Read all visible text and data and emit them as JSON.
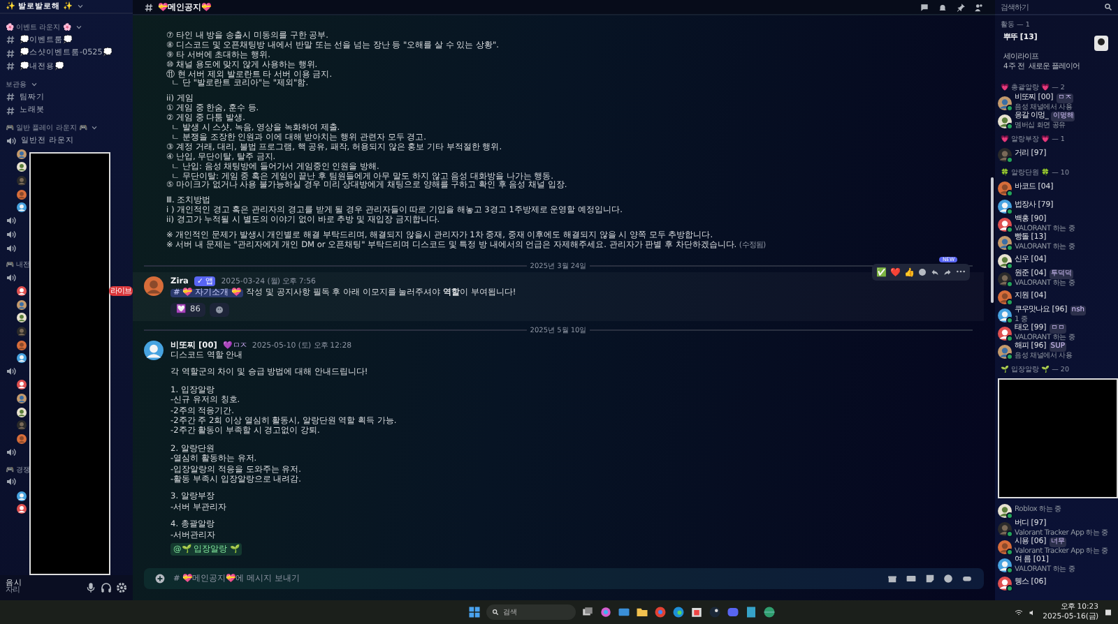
{
  "server": {
    "name": "✨ 발로발로해 ✨"
  },
  "sidebar": {
    "items": [
      {
        "kind": "category",
        "label": "🌸 이벤트 라운지 🌸"
      },
      {
        "kind": "text",
        "label": "💭이벤트룸💭"
      },
      {
        "kind": "text",
        "label": "💭스샷이벤트룸-0525💭"
      },
      {
        "kind": "text",
        "label": "💭내전용💭"
      },
      {
        "kind": "category",
        "label": "보관용"
      },
      {
        "kind": "text",
        "label": "팀짜기"
      },
      {
        "kind": "text",
        "label": "노래봇"
      },
      {
        "kind": "category",
        "label": "🎮 일반 플레이 라운지 🎮"
      },
      {
        "kind": "voice",
        "label": "일반전 라운지"
      },
      {
        "kind": "user"
      },
      {
        "kind": "user"
      },
      {
        "kind": "user"
      },
      {
        "kind": "user"
      },
      {
        "kind": "user"
      },
      {
        "kind": "voice"
      },
      {
        "kind": "voice"
      },
      {
        "kind": "voice"
      },
      {
        "kind": "category",
        "label": "🎮 내전"
      },
      {
        "kind": "voice"
      },
      {
        "kind": "user",
        "badge": "라이브"
      },
      {
        "kind": "user"
      },
      {
        "kind": "user"
      },
      {
        "kind": "user"
      },
      {
        "kind": "user"
      },
      {
        "kind": "user"
      },
      {
        "kind": "voice"
      },
      {
        "kind": "user"
      },
      {
        "kind": "user"
      },
      {
        "kind": "user"
      },
      {
        "kind": "user"
      },
      {
        "kind": "user"
      },
      {
        "kind": "voice"
      },
      {
        "kind": "category",
        "label": "🎮 경쟁"
      },
      {
        "kind": "voice"
      },
      {
        "kind": "user"
      },
      {
        "kind": "user"
      }
    ]
  },
  "user_panel": {
    "name": "음시",
    "status": "자리"
  },
  "channel": {
    "name": "💝메인공지💝"
  },
  "messages": {
    "continued": {
      "paragraphs": [
        [
          "⑦ 타인 내 방을 송출시 미동의를 구한 공부.",
          "⑧ 디스코드 및 오픈채팅방 내에서 반말 또는 선을 넘는 장난 등 \"오해를 살 수 있는 상황\".",
          "⑨ 타 서버에 초대하는 행위.",
          "⑩ 채널 용도에 맞지 않게 사용하는 행위.",
          "⑪ 현 서버 제외 발로란트 타 서버 이용 금지.",
          "  ㄴ 단 \"발로란트 코리아\"는 \"제외\"함."
        ],
        [
          "ii) 게임",
          "① 게임 중 한숨, 훈수 등.",
          "② 게임 중 다툼 발생.",
          "  ㄴ 발생 시 스샷, 녹음, 영상을 녹화하여 제출.",
          "  ㄴ 분쟁을 조장한 인원과 이에 대해 받아치는 행위 관련자 모두 경고.",
          "③ 계정 거래, 대리, 불법 프로그램, 핵 공유, 패작, 허용되지 않은 홍보 기타 부적절한 행위.",
          "④ 난입, 무단이탈, 탈주 금지.",
          "  ㄴ 난입: 음성 채팅방에 들어가서 게임중인 인원을 방해.",
          "  ㄴ 무단이탈: 게임 중 혹은 게임이 끝난 후 팀원들에게 아무 말도 하지 않고 음성 대화방을 나가는 행동.",
          "⑤ 마이크가 없거나 사용 불가능하실 경우 미리 상대방에게 채팅으로 양해를 구하고 확인 후 음성 채널 입장."
        ],
        [
          "Ⅲ. 조치방법",
          "i ) 개인적인 경고 혹은 관리자의 경고를 받게 될 경우 관리자들이 따로 기입을 해놓고 3경고 1주방제로 운영할 예정입니다.",
          "ii) 경고가 누적될 시 별도의 이야기 없이 바로 추방 및 재입장 금지합니다."
        ],
        [
          "※ 개인적인 문제가 발생시 개인별로 해결 부탁드리며, 해결되지 않을시 관리자가 1차 중재, 중재 이후에도 해결되지 않을 시 양쪽 모두 추방합니다.",
          "※ 서버 내 문제는 \"관리자에게 개인 DM or 오픈채팅\" 부탁드리며 디스코드 및 특정 방 내에서의 언급은 자제해주세요. 관리자가 판별 후 차단하겠습니다."
        ]
      ],
      "edited": "(수정됨)"
    },
    "dividers": [
      "2025년 3월 24일",
      "2025년 5월 10일"
    ],
    "posts": [
      {
        "author": "Zira",
        "tag": "✓ 앱",
        "time": "2025-03-24 (월) 오후 7:56",
        "mention": "# 💝 자기소개 💝",
        "text": "작성 및 공지사항 필독 후 아래 이모지를 눌러주셔야 **역할**이 부여됩니다!",
        "reactions": [
          {
            "emoji": "💟",
            "count": "86"
          }
        ],
        "hovered": true
      },
      {
        "author": "비또찌 [00]",
        "tag": "💜ㅁㅈ",
        "time": "2025-05-10 (토) 오후 12:28",
        "paragraphs": [
          [
            "디스코드 역할 안내"
          ],
          [
            "각 역할군의 차이 및 승급 방법에 대해 안내드립니다!"
          ],
          [
            "1. 입장알랑",
            "-신규 유저의 칭호.",
            "-2주의 적응기간.",
            "-2주간 주 2회 이상 열심히 활동시, 알랑단원 역할 획득 가능.",
            "-2주간 활동이 부족할 시 경고없이 강퇴."
          ],
          [
            "2. 알랑단원",
            "-열심히 활동하는 유저.",
            "-입장알랑의 적응을 도와주는 유저.",
            "-활동 부족시 입장알랑으로 내려감."
          ],
          [
            "3. 알랑부장",
            "-서버 부관리자"
          ],
          [
            "4. 총괄알랑",
            "-서버관리자"
          ]
        ],
        "role_mention": "@🌱 입장알랑 🌱",
        "hovered": false
      }
    ],
    "toolbar": {
      "quick_reactions": [
        "✅",
        "❤️",
        "👍"
      ],
      "new_badge": "NEW"
    }
  },
  "composer": {
    "placeholder": "# 💝메인공지💝에 메시지 보내기"
  },
  "members": {
    "search": {
      "placeholder": "검색하기"
    },
    "activity": {
      "label": "활동 — 1",
      "name": "뿌뚜 [13]",
      "game": "세이라이프",
      "since": "4주 전",
      "detail": "새로운 플레이어"
    },
    "groups": [
      {
        "label": "💗 총괄알랑 💗 — 2",
        "members": [
          {
            "name": "비또찌 [00]",
            "tag": "ㅁㅈ",
            "status": "음성 채널에서 사용"
          },
          {
            "name": "응갈 이멍_",
            "tag": "이멍해",
            "status": "멤버십 화면 공유"
          }
        ]
      },
      {
        "label": "💗 알랑부장 💗 — 1",
        "members": [
          {
            "name": "거리 [97]"
          }
        ]
      },
      {
        "label": "🍀 알랑단원 🍀 — 10",
        "members": [
          {
            "name": "바코드 [04]"
          },
          {
            "name": "법장사 [79]"
          },
          {
            "name": "백홍 [90]",
            "status": "VALORANT 하는 중"
          },
          {
            "name": "빵돌 [13]",
            "status": "VALORANT 하는 중"
          },
          {
            "name": "신우 [04]"
          },
          {
            "name": "원준 [04]",
            "tag": "투덕덕",
            "status": "VALORANT 하는 중"
          },
          {
            "name": "지원 [04]"
          },
          {
            "name": "쿠우맛나요 [96]",
            "tag": "nsh",
            "status": "1 중"
          },
          {
            "name": "태오 [99]",
            "tag": "ㅁㅁ",
            "status": "VALORANT 하는 중"
          },
          {
            "name": "해피 [96]",
            "tag": "SUP",
            "status": "음성 채널에서 사용"
          }
        ]
      },
      {
        "label": "🌱 입장알랑 🌱 — 20",
        "redacted": true,
        "members": [
          {
            "name": "Roblox 하는 중",
            "kind": "status-only"
          },
          {
            "name": "버디 [97]",
            "status": "Valorant Tracker App 하는 중"
          },
          {
            "name": "시용 [06]",
            "tag": "너무",
            "status": "Valorant Tracker App 하는 중"
          },
          {
            "name": "여 름 [01]",
            "status": "VALORANT 하는 중"
          },
          {
            "name": "웽스 [06]"
          }
        ]
      }
    ]
  },
  "taskbar": {
    "search": {
      "placeholder": "검색"
    },
    "time": "오후 10:23",
    "date": "2025-05-16(금)"
  }
}
